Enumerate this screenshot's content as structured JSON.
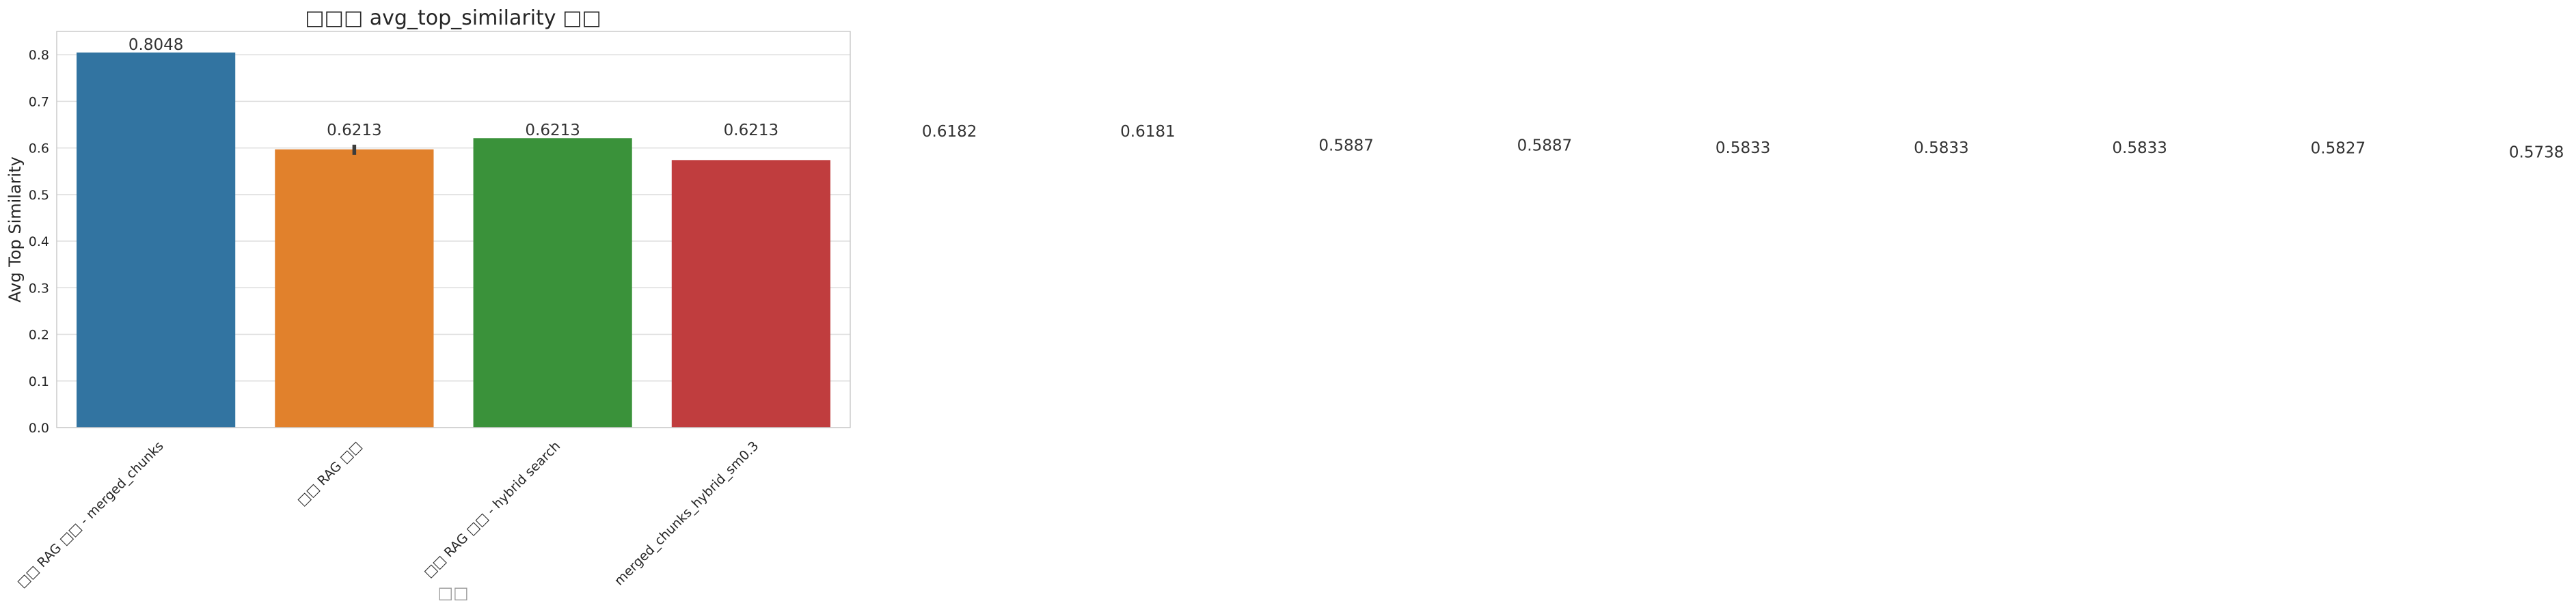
{
  "chart_data": {
    "type": "bar",
    "title": "□□□ avg_top_similarity □□",
    "xlabel": "□□",
    "ylabel": "Avg Top Similarity",
    "ylim": [
      0,
      0.85
    ],
    "yticks": [
      "0.0",
      "0.1",
      "0.2",
      "0.3",
      "0.4",
      "0.5",
      "0.6",
      "0.7",
      "0.8"
    ],
    "grid": true,
    "categories": [
      "□□ RAG □□ - merged_chunks",
      "□□ RAG □□",
      "□□ RAG □□ - hybrid search",
      "merged_chunks_hybrid_sm0.3"
    ],
    "values": [
      0.8048,
      0.597,
      0.621,
      0.574
    ],
    "error_bar": {
      "category_index": 1,
      "low": 0.585,
      "high": 0.607
    },
    "colors": [
      "#3274a1",
      "#e1812c",
      "#3a923a",
      "#c03d3e"
    ],
    "value_labels": [
      "0.8048",
      "0.6213",
      "0.6213",
      "0.6213",
      "0.6182",
      "0.6181",
      "0.5887",
      "0.5887",
      "0.5833",
      "0.5833",
      "0.5833",
      "0.5827",
      "0.5738"
    ]
  }
}
